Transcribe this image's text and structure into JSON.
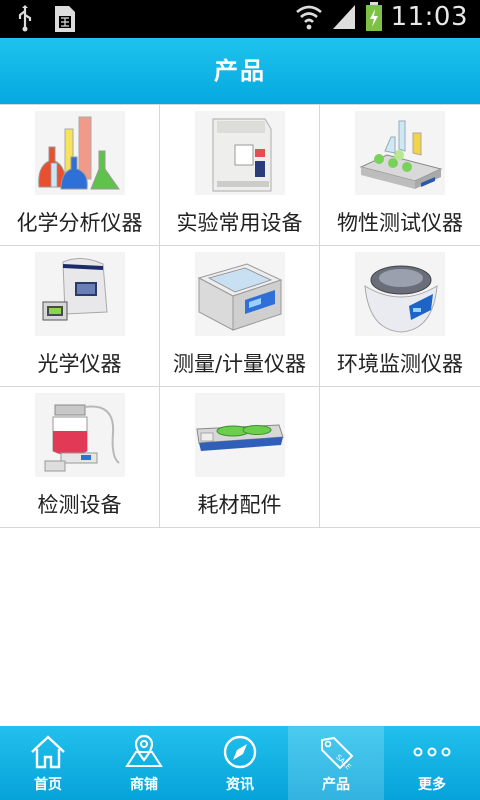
{
  "status_bar": {
    "time": "11:03",
    "icons": [
      "usb-icon",
      "sim-card-icon",
      "wifi-icon",
      "signal-icon",
      "battery-charging-icon"
    ]
  },
  "header": {
    "title": "产品"
  },
  "categories": [
    {
      "label": "化学分析仪器",
      "image": "glass-flasks"
    },
    {
      "label": "实验常用设备",
      "image": "analyzer-machine"
    },
    {
      "label": "物性测试仪器",
      "image": "shaker-platform"
    },
    {
      "label": "光学仪器",
      "image": "thermal-cycler"
    },
    {
      "label": "测量/计量仪器",
      "image": "measuring-box"
    },
    {
      "label": "环境监测仪器",
      "image": "centrifuge"
    },
    {
      "label": "检测设备",
      "image": "vacuum-aspirator"
    },
    {
      "label": "耗材配件",
      "image": "rocker-mixer"
    }
  ],
  "bottom_nav": [
    {
      "label": "首页",
      "icon": "home-icon"
    },
    {
      "label": "商铺",
      "icon": "map-pin-icon"
    },
    {
      "label": "资讯",
      "icon": "compass-icon"
    },
    {
      "label": "产品",
      "icon": "sale-tag-icon",
      "active": true
    },
    {
      "label": "更多",
      "icon": "more-dots-icon"
    }
  ],
  "colors": {
    "accent": "#0aaee2",
    "status_bar": "#000000",
    "background": "#ffffff",
    "grid_line": "#d6d6d6"
  }
}
